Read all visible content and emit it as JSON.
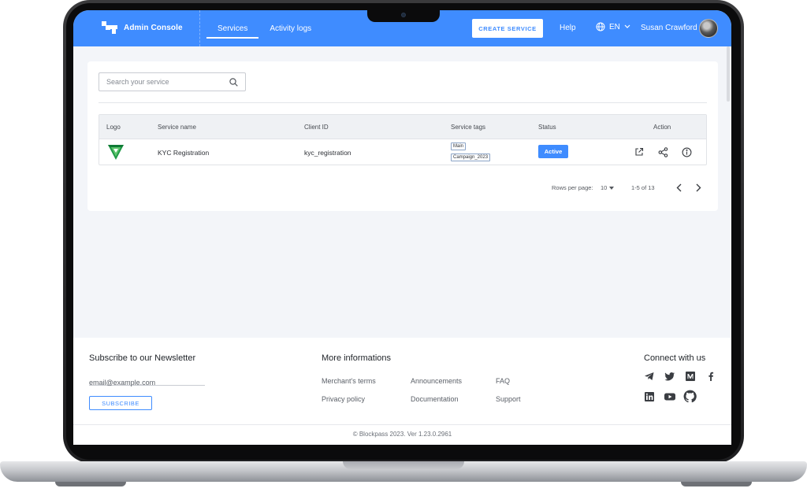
{
  "header": {
    "app_title": "Admin Console",
    "tabs": [
      {
        "label": "Services",
        "active": true
      },
      {
        "label": "Activity logs",
        "active": false
      }
    ],
    "create_button": "CREATE SERVICE",
    "help": "Help",
    "language": "EN",
    "user_name": "Susan Crawford",
    "accent_color": "#3f8cff"
  },
  "search": {
    "placeholder": "Search your service"
  },
  "table": {
    "columns": [
      "Logo",
      "Service name",
      "Client ID",
      "Service tags",
      "Status",
      "Action"
    ],
    "rows": [
      {
        "service_name": "KYC Registration",
        "client_id": "kyc_registration",
        "tags": [
          "Main",
          "Campaign_2023"
        ],
        "status": "Active",
        "actions": [
          "open-external-icon",
          "share-icon",
          "info-icon"
        ]
      }
    ]
  },
  "pagination": {
    "rows_per_page_label": "Rows per page:",
    "rows_per_page": "10",
    "range": "1-5 of 13"
  },
  "footer": {
    "newsletter_title": "Subscribe to our Newsletter",
    "email_placeholder": "email@example.com",
    "subscribe_button": "SUBSCRIBE",
    "more_title": "More informations",
    "links": [
      "Merchant's terms",
      "Announcements",
      "FAQ",
      "Privacy policy",
      "Documentation",
      "Support"
    ],
    "connect_title": "Connect with us",
    "social": [
      "telegram-icon",
      "twitter-icon",
      "medium-icon",
      "facebook-icon",
      "linkedin-icon",
      "youtube-icon",
      "github-icon"
    ],
    "copyright": "© Blockpass 2023. Ver 1.23.0.2961"
  }
}
